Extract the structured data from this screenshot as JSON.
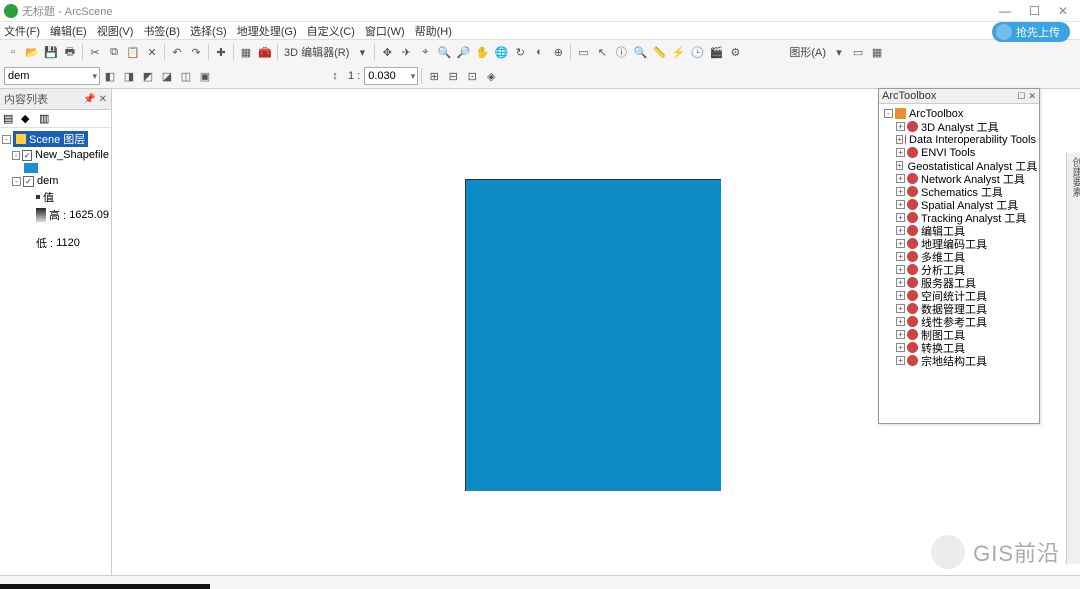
{
  "window": {
    "title": "无标题 - ArcScene"
  },
  "menubar": [
    "文件(F)",
    "编辑(E)",
    "视图(V)",
    "书签(B)",
    "选择(S)",
    "地理处理(G)",
    "自定义(C)",
    "窗口(W)",
    "帮助(H)"
  ],
  "toolbar": {
    "layer_combo": "dem",
    "editor_label": "3D 编辑器(R)",
    "scale_sep": "1 :",
    "scale_value": "0.030",
    "graphics_label": "图形(A)"
  },
  "share_btn": "抢先上传",
  "toc": {
    "title": "内容列表",
    "scene": "Scene 图层",
    "layers": [
      {
        "name": "New_Shapefile",
        "checked": true,
        "swatch": "blue"
      },
      {
        "name": "dem",
        "checked": true,
        "high_label": "高 :",
        "high": "1625.09",
        "low_label": "低 :",
        "low": "1120"
      }
    ]
  },
  "arctoolbox": {
    "title": "ArcToolbox",
    "root": "ArcToolbox",
    "items": [
      "3D Analyst 工具",
      "Data Interoperability Tools",
      "ENVI Tools",
      "Geostatistical Analyst 工具",
      "Network Analyst 工具",
      "Schematics 工具",
      "Spatial Analyst 工具",
      "Tracking Analyst 工具",
      "编辑工具",
      "地理编码工具",
      "多维工具",
      "分析工具",
      "服务器工具",
      "空间统计工具",
      "数据管理工具",
      "线性参考工具",
      "制图工具",
      "转换工具",
      "宗地结构工具"
    ]
  },
  "right_rail": "创建要素",
  "watermark": "GIS前沿"
}
